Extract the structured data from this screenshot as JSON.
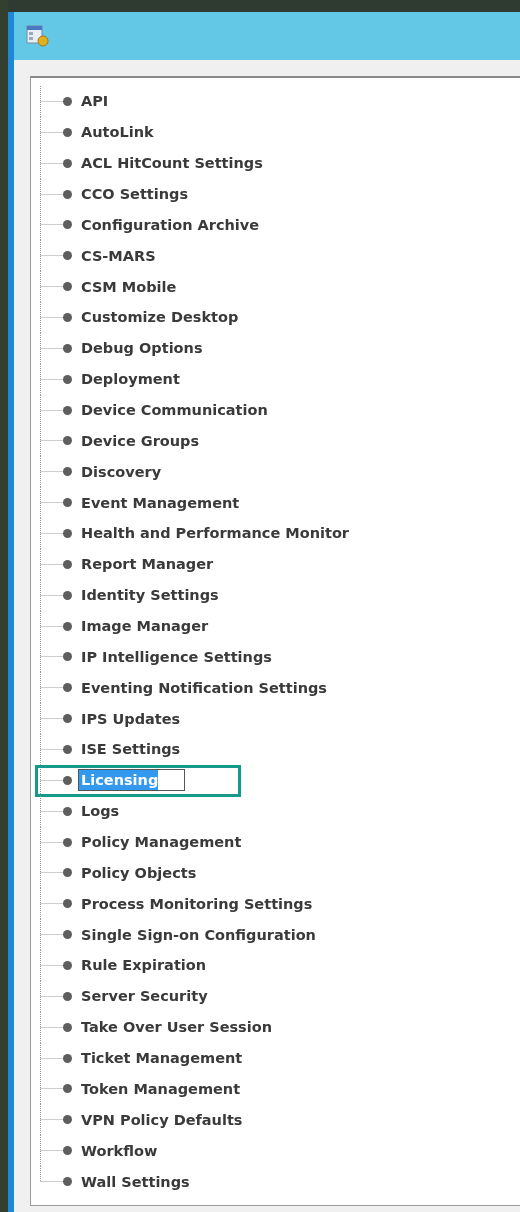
{
  "tree": {
    "items": [
      {
        "label": "API",
        "selected": false,
        "outlined": false
      },
      {
        "label": "AutoLink",
        "selected": false,
        "outlined": false
      },
      {
        "label": "ACL HitCount Settings",
        "selected": false,
        "outlined": false
      },
      {
        "label": "CCO Settings",
        "selected": false,
        "outlined": false
      },
      {
        "label": "Configuration Archive",
        "selected": false,
        "outlined": false
      },
      {
        "label": "CS-MARS",
        "selected": false,
        "outlined": false
      },
      {
        "label": "CSM Mobile",
        "selected": false,
        "outlined": false
      },
      {
        "label": "Customize Desktop",
        "selected": false,
        "outlined": false
      },
      {
        "label": "Debug Options",
        "selected": false,
        "outlined": false
      },
      {
        "label": "Deployment",
        "selected": false,
        "outlined": false
      },
      {
        "label": "Device Communication",
        "selected": false,
        "outlined": false
      },
      {
        "label": "Device Groups",
        "selected": false,
        "outlined": false
      },
      {
        "label": "Discovery",
        "selected": false,
        "outlined": false
      },
      {
        "label": "Event Management",
        "selected": false,
        "outlined": false
      },
      {
        "label": "Health and Performance Monitor",
        "selected": false,
        "outlined": false
      },
      {
        "label": "Report Manager",
        "selected": false,
        "outlined": false
      },
      {
        "label": "Identity Settings",
        "selected": false,
        "outlined": false
      },
      {
        "label": "Image Manager",
        "selected": false,
        "outlined": false
      },
      {
        "label": "IP Intelligence Settings",
        "selected": false,
        "outlined": false
      },
      {
        "label": "Eventing Notification Settings",
        "selected": false,
        "outlined": false
      },
      {
        "label": "IPS Updates",
        "selected": false,
        "outlined": false
      },
      {
        "label": "ISE Settings",
        "selected": false,
        "outlined": false
      },
      {
        "label": "Licensing",
        "selected": true,
        "outlined": true
      },
      {
        "label": "Logs",
        "selected": false,
        "outlined": false
      },
      {
        "label": "Policy Management",
        "selected": false,
        "outlined": false
      },
      {
        "label": "Policy Objects",
        "selected": false,
        "outlined": false
      },
      {
        "label": "Process Monitoring Settings",
        "selected": false,
        "outlined": false
      },
      {
        "label": "Single Sign-on Configuration",
        "selected": false,
        "outlined": false
      },
      {
        "label": "Rule Expiration",
        "selected": false,
        "outlined": false
      },
      {
        "label": "Server Security",
        "selected": false,
        "outlined": false
      },
      {
        "label": "Take Over User Session",
        "selected": false,
        "outlined": false
      },
      {
        "label": "Ticket Management",
        "selected": false,
        "outlined": false
      },
      {
        "label": "Token Management",
        "selected": false,
        "outlined": false
      },
      {
        "label": "VPN Policy Defaults",
        "selected": false,
        "outlined": false
      },
      {
        "label": "Workflow",
        "selected": false,
        "outlined": false
      },
      {
        "label": "Wall Settings",
        "selected": false,
        "outlined": false
      }
    ]
  }
}
